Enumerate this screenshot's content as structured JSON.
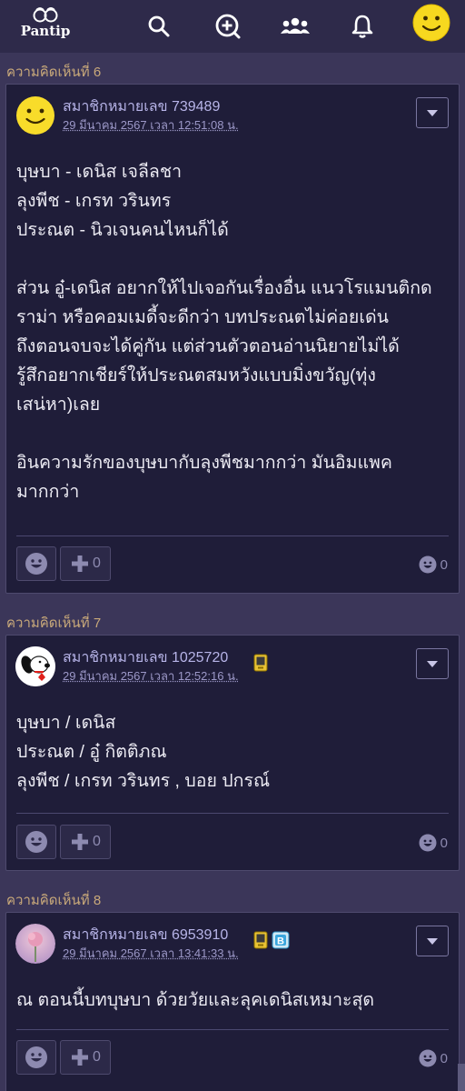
{
  "app": {
    "name": "Pantip"
  },
  "colors": {
    "background": "#3b3659",
    "navbar": "#2e2a4a",
    "card": "#1f1d39",
    "label": "#c9a97a",
    "member": "#b7b4e8"
  },
  "navbar": {
    "logo_text": "Pantip",
    "icons": [
      "search-icon",
      "add-topic-icon",
      "community-icon",
      "bell-icon",
      "profile-avatar"
    ]
  },
  "comments": [
    {
      "label": "ความคิดเห็นที่ 6",
      "member": "สมาชิกหมายเลข 739489",
      "time": "29 มีนาคม 2567 เวลา 12:51:08 น.",
      "avatar": "smiley",
      "badges": [],
      "body": "บุษบา - เดนิส เจลีลชา\nลุงพีช - เกรท วรินทร\nประณต - นิวเจนคนไหนก็ได้\n\nส่วน อู๋-เดนิส อยากให้ไปเจอกันเรื่องอื่น แนวโรแมนติกด\nราม่า หรือคอมเมดี้จะดีกว่า บทประณตไม่ค่อยเด่น\nถึงตอนจบจะได้คู่กัน แต่ส่วนตัวตอนอ่านนิยายไม่ได้\nรู้สึกอยากเชียร์ให้ประณตสมหวังแบบมิ่งขวัญ(ทุ่ง\nเสน่หา)เลย\n\nอินความรักของบุษบากับลุงพีชมากกว่า มันอิมแพค\nมากกว่า",
      "plus_count": "0",
      "emotion_count": "0"
    },
    {
      "label": "ความคิดเห็นที่ 7",
      "member": "สมาชิกหมายเลข 1025720",
      "time": "29 มีนาคม 2567 เวลา 12:52:16 น.",
      "avatar": "snoopy",
      "badges": [
        "phone-badge-icon"
      ],
      "body": "บุษบา / เดนิส\nประณต / อู๋ กิตติภณ\nลุงพีช / เกรท วรินทร , บอย ปกรณ์",
      "plus_count": "0",
      "emotion_count": "0"
    },
    {
      "label": "ความคิดเห็นที่ 8",
      "member": "สมาชิกหมายเลข 6953910",
      "time": "29 มีนาคม 2567 เวลา 13:41:33 น.",
      "avatar": "flower",
      "badges": [
        "phone-badge-icon",
        "blog-badge-icon"
      ],
      "blog_badge_letter": "B",
      "body": "ณ ตอนนี้บทบุษบา ด้วยวัยและลุคเดนิสเหมาะสุด",
      "plus_count": "0",
      "emotion_count": "0"
    }
  ]
}
